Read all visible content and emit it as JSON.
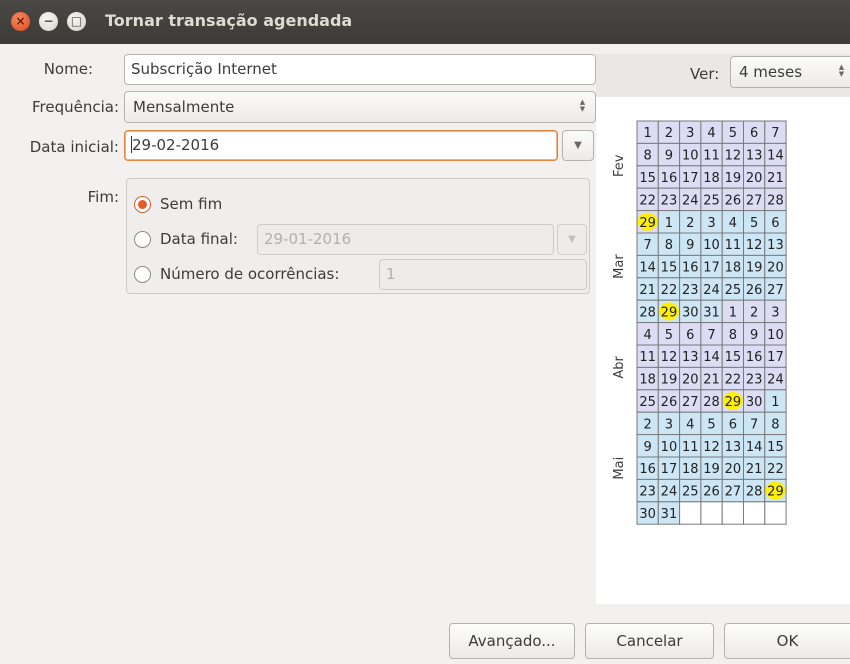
{
  "window": {
    "title": "Tornar transação agendada"
  },
  "form": {
    "name_label": "Nome:",
    "name_value": "Subscrição Internet",
    "freq_label": "Frequência:",
    "freq_value": "Mensalmente",
    "start_label": "Data inicial:",
    "start_value": "29-02-2016",
    "end_label": "Fim:",
    "end_options": {
      "none": "Sem fim",
      "final_date": "Data final:",
      "occurrences": "Número de ocorrências:"
    },
    "end_selected": "none",
    "final_date_value": "29-01-2016",
    "occurrences_value": "1"
  },
  "calendar": {
    "view_label": "Ver:",
    "view_value": "4 meses",
    "colors": {
      "odd_month": "#dcdcf5",
      "even_month": "#cde6f6",
      "highlight": "#ffef00",
      "grid": "#7a7a7a"
    },
    "months": [
      {
        "name": "Fev",
        "rows": [
          [
            "1",
            "2",
            "3",
            "4",
            "5",
            "6",
            "7"
          ],
          [
            "8",
            "9",
            "10",
            "11",
            "12",
            "13",
            "14"
          ],
          [
            "15",
            "16",
            "17",
            "18",
            "19",
            "20",
            "21"
          ],
          [
            "22",
            "23",
            "24",
            "25",
            "26",
            "27",
            "28"
          ]
        ]
      },
      {
        "name": "Mar",
        "rows": [
          [
            "29",
            "1",
            "2",
            "3",
            "4",
            "5",
            "6"
          ],
          [
            "7",
            "8",
            "9",
            "10",
            "11",
            "12",
            "13"
          ],
          [
            "14",
            "15",
            "16",
            "17",
            "18",
            "19",
            "20"
          ],
          [
            "21",
            "22",
            "23",
            "24",
            "25",
            "26",
            "27"
          ],
          [
            "28",
            "29",
            "30",
            "31",
            "1",
            "2",
            "3"
          ]
        ]
      },
      {
        "name": "Abr",
        "rows": [
          [
            "4",
            "5",
            "6",
            "7",
            "8",
            "9",
            "10"
          ],
          [
            "11",
            "12",
            "13",
            "14",
            "15",
            "16",
            "17"
          ],
          [
            "18",
            "19",
            "20",
            "21",
            "22",
            "23",
            "24"
          ],
          [
            "25",
            "26",
            "27",
            "28",
            "29",
            "30",
            "1"
          ]
        ]
      },
      {
        "name": "Mai",
        "rows": [
          [
            "2",
            "3",
            "4",
            "5",
            "6",
            "7",
            "8"
          ],
          [
            "9",
            "10",
            "11",
            "12",
            "13",
            "14",
            "15"
          ],
          [
            "16",
            "17",
            "18",
            "19",
            "20",
            "21",
            "22"
          ],
          [
            "23",
            "24",
            "25",
            "26",
            "27",
            "28",
            "29"
          ],
          [
            "30",
            "31",
            "",
            "",
            "",
            "",
            ""
          ]
        ]
      }
    ],
    "highlighted": [
      [
        1,
        0,
        0
      ],
      [
        1,
        4,
        1
      ],
      [
        2,
        3,
        4
      ],
      [
        3,
        3,
        6
      ]
    ],
    "month_of_cell": [
      [
        0,
        0,
        0,
        0,
        0,
        0,
        0
      ],
      [
        0,
        0,
        0,
        0,
        0,
        0,
        0
      ],
      [
        0,
        0,
        0,
        0,
        0,
        0,
        0
      ],
      [
        0,
        0,
        0,
        0,
        0,
        0,
        0
      ],
      [
        0,
        1,
        1,
        1,
        1,
        1,
        1
      ],
      [
        1,
        1,
        1,
        1,
        1,
        1,
        1
      ],
      [
        1,
        1,
        1,
        1,
        1,
        1,
        1
      ],
      [
        1,
        1,
        1,
        1,
        1,
        1,
        1
      ],
      [
        1,
        1,
        1,
        1,
        2,
        2,
        2
      ],
      [
        2,
        2,
        2,
        2,
        2,
        2,
        2
      ],
      [
        2,
        2,
        2,
        2,
        2,
        2,
        2
      ],
      [
        2,
        2,
        2,
        2,
        2,
        2,
        2
      ],
      [
        2,
        2,
        2,
        2,
        2,
        2,
        3
      ],
      [
        3,
        3,
        3,
        3,
        3,
        3,
        3
      ],
      [
        3,
        3,
        3,
        3,
        3,
        3,
        3
      ],
      [
        3,
        3,
        3,
        3,
        3,
        3,
        3
      ],
      [
        3,
        3,
        3,
        3,
        3,
        3,
        3
      ],
      [
        3,
        3,
        -1,
        -1,
        -1,
        -1,
        -1
      ]
    ]
  },
  "buttons": {
    "advanced": "Avançado...",
    "cancel": "Cancelar",
    "ok": "OK"
  }
}
